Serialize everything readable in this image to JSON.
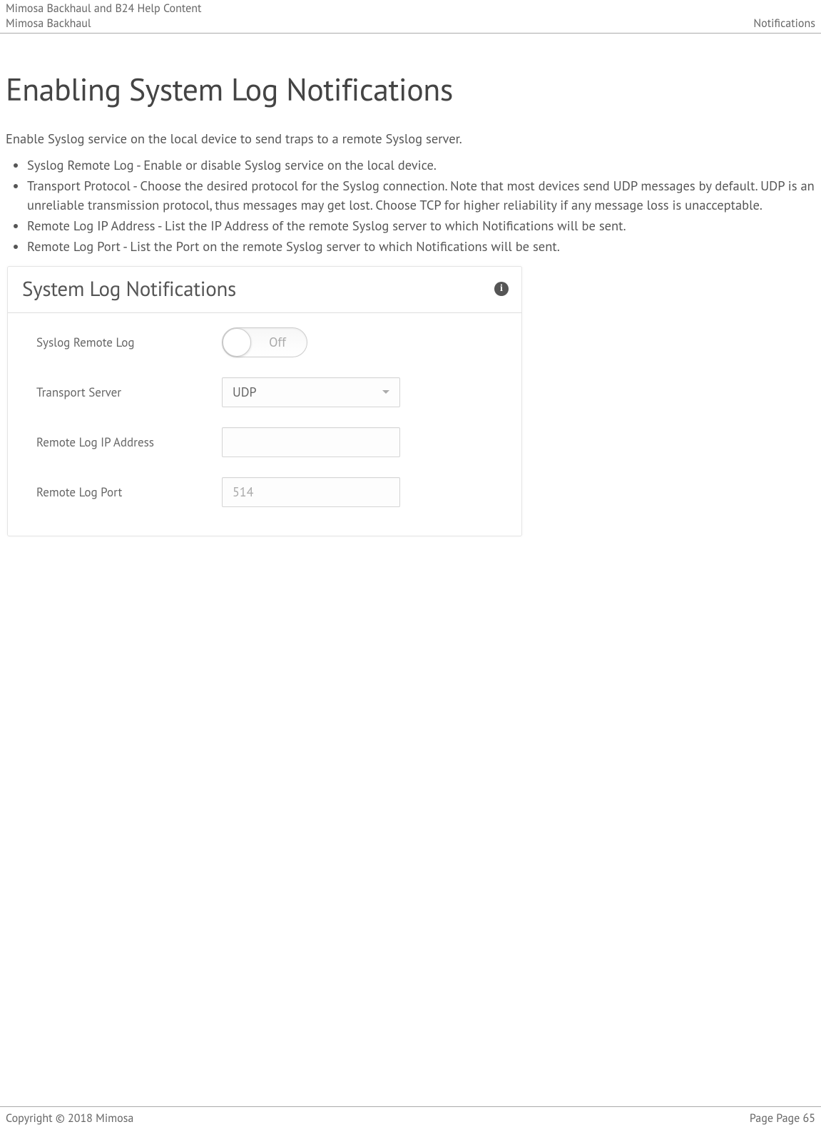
{
  "header": {
    "line1": "Mimosa Backhaul and B24 Help Content",
    "left": "Mimosa Backhaul",
    "right": "Notifications"
  },
  "page": {
    "title": "Enabling System Log Notifications",
    "intro": "Enable Syslog service on the local device to send traps to a remote Syslog server.",
    "bullets": [
      "Syslog Remote Log - Enable or disable Syslog service on the local device.",
      "Transport Protocol - Choose the desired protocol for the Syslog connection. Note that most devices send UDP messages by default. UDP is an unreliable transmission protocol, thus messages may get lost. Choose TCP for higher reliability if any message loss is unacceptable.",
      "Remote Log IP Address - List the IP Address of the remote Syslog server to which Notifications will be sent.",
      "Remote Log Port - List the Port on the remote Syslog server to which Notifications will be sent."
    ]
  },
  "panel": {
    "title": "System Log Notifications",
    "info_symbol": "i",
    "rows": {
      "syslog_remote": {
        "label": "Syslog Remote Log",
        "toggle_value": "Off"
      },
      "transport": {
        "label": "Transport Server",
        "value": "UDP"
      },
      "ip": {
        "label": "Remote Log IP Address",
        "value": ""
      },
      "port": {
        "label": "Remote Log Port",
        "value": "514"
      }
    }
  },
  "footer": {
    "left": "Copyright © 2018 Mimosa",
    "right": "Page Page 65"
  }
}
